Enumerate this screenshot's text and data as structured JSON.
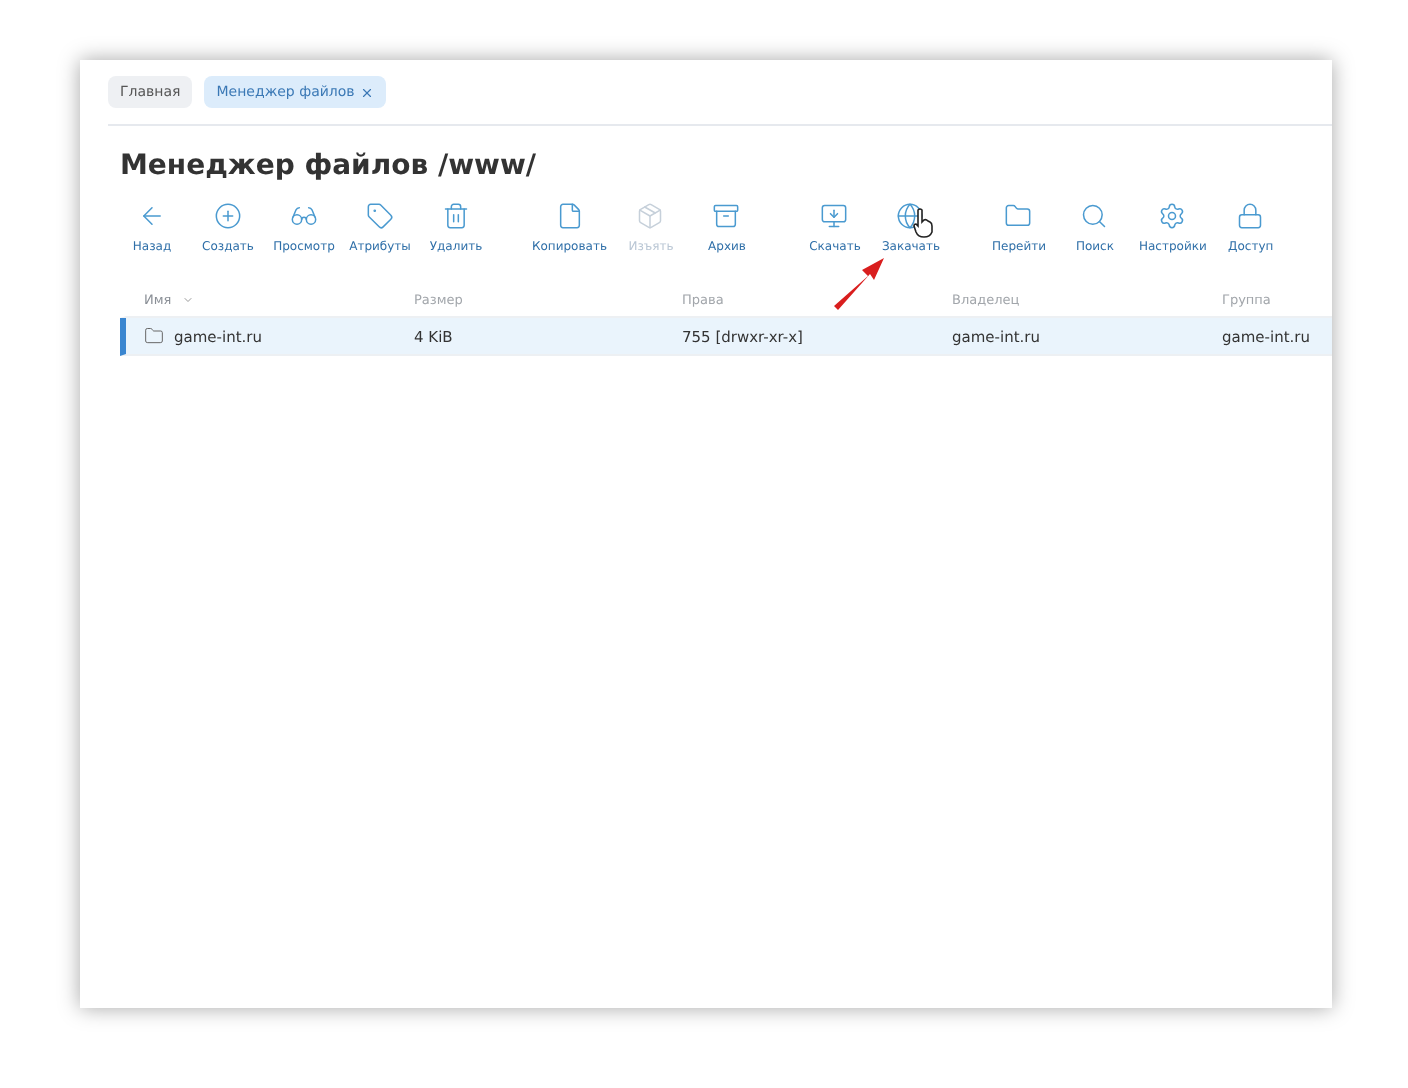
{
  "tabs": [
    {
      "label": "Главная",
      "selected": false,
      "closable": false
    },
    {
      "label": "Менеджер файлов",
      "selected": true,
      "closable": true
    }
  ],
  "title": "Менеджер файлов /www/",
  "toolbar": [
    [
      {
        "label": "Назад",
        "disabled": false
      },
      {
        "label": "Создать",
        "disabled": false
      },
      {
        "label": "Просмотр",
        "disabled": false
      },
      {
        "label": "Атрибуты",
        "disabled": false
      },
      {
        "label": "Удалить",
        "disabled": false
      }
    ],
    [
      {
        "label": "Копировать",
        "disabled": false
      },
      {
        "label": "Изъять",
        "disabled": true
      },
      {
        "label": "Архив",
        "disabled": false
      }
    ],
    [
      {
        "label": "Скачать",
        "disabled": false
      },
      {
        "label": "Закачать",
        "disabled": false
      }
    ],
    [
      {
        "label": "Перейти",
        "disabled": false
      },
      {
        "label": "Поиск",
        "disabled": false
      },
      {
        "label": "Настройки",
        "disabled": false
      },
      {
        "label": "Доступ",
        "disabled": false
      }
    ]
  ],
  "table": {
    "columns": [
      {
        "label": "Имя",
        "sorted": true
      },
      {
        "label": "Размер",
        "sorted": false
      },
      {
        "label": "Права",
        "sorted": false
      },
      {
        "label": "Владелец",
        "sorted": false
      },
      {
        "label": "Группа",
        "sorted": false
      }
    ],
    "rows": [
      {
        "selected": true,
        "cells": [
          "game-int.ru",
          "4 KiB",
          "755 [drwxr-xr-x]",
          "game-int.ru",
          "game-int.ru"
        ]
      }
    ]
  }
}
